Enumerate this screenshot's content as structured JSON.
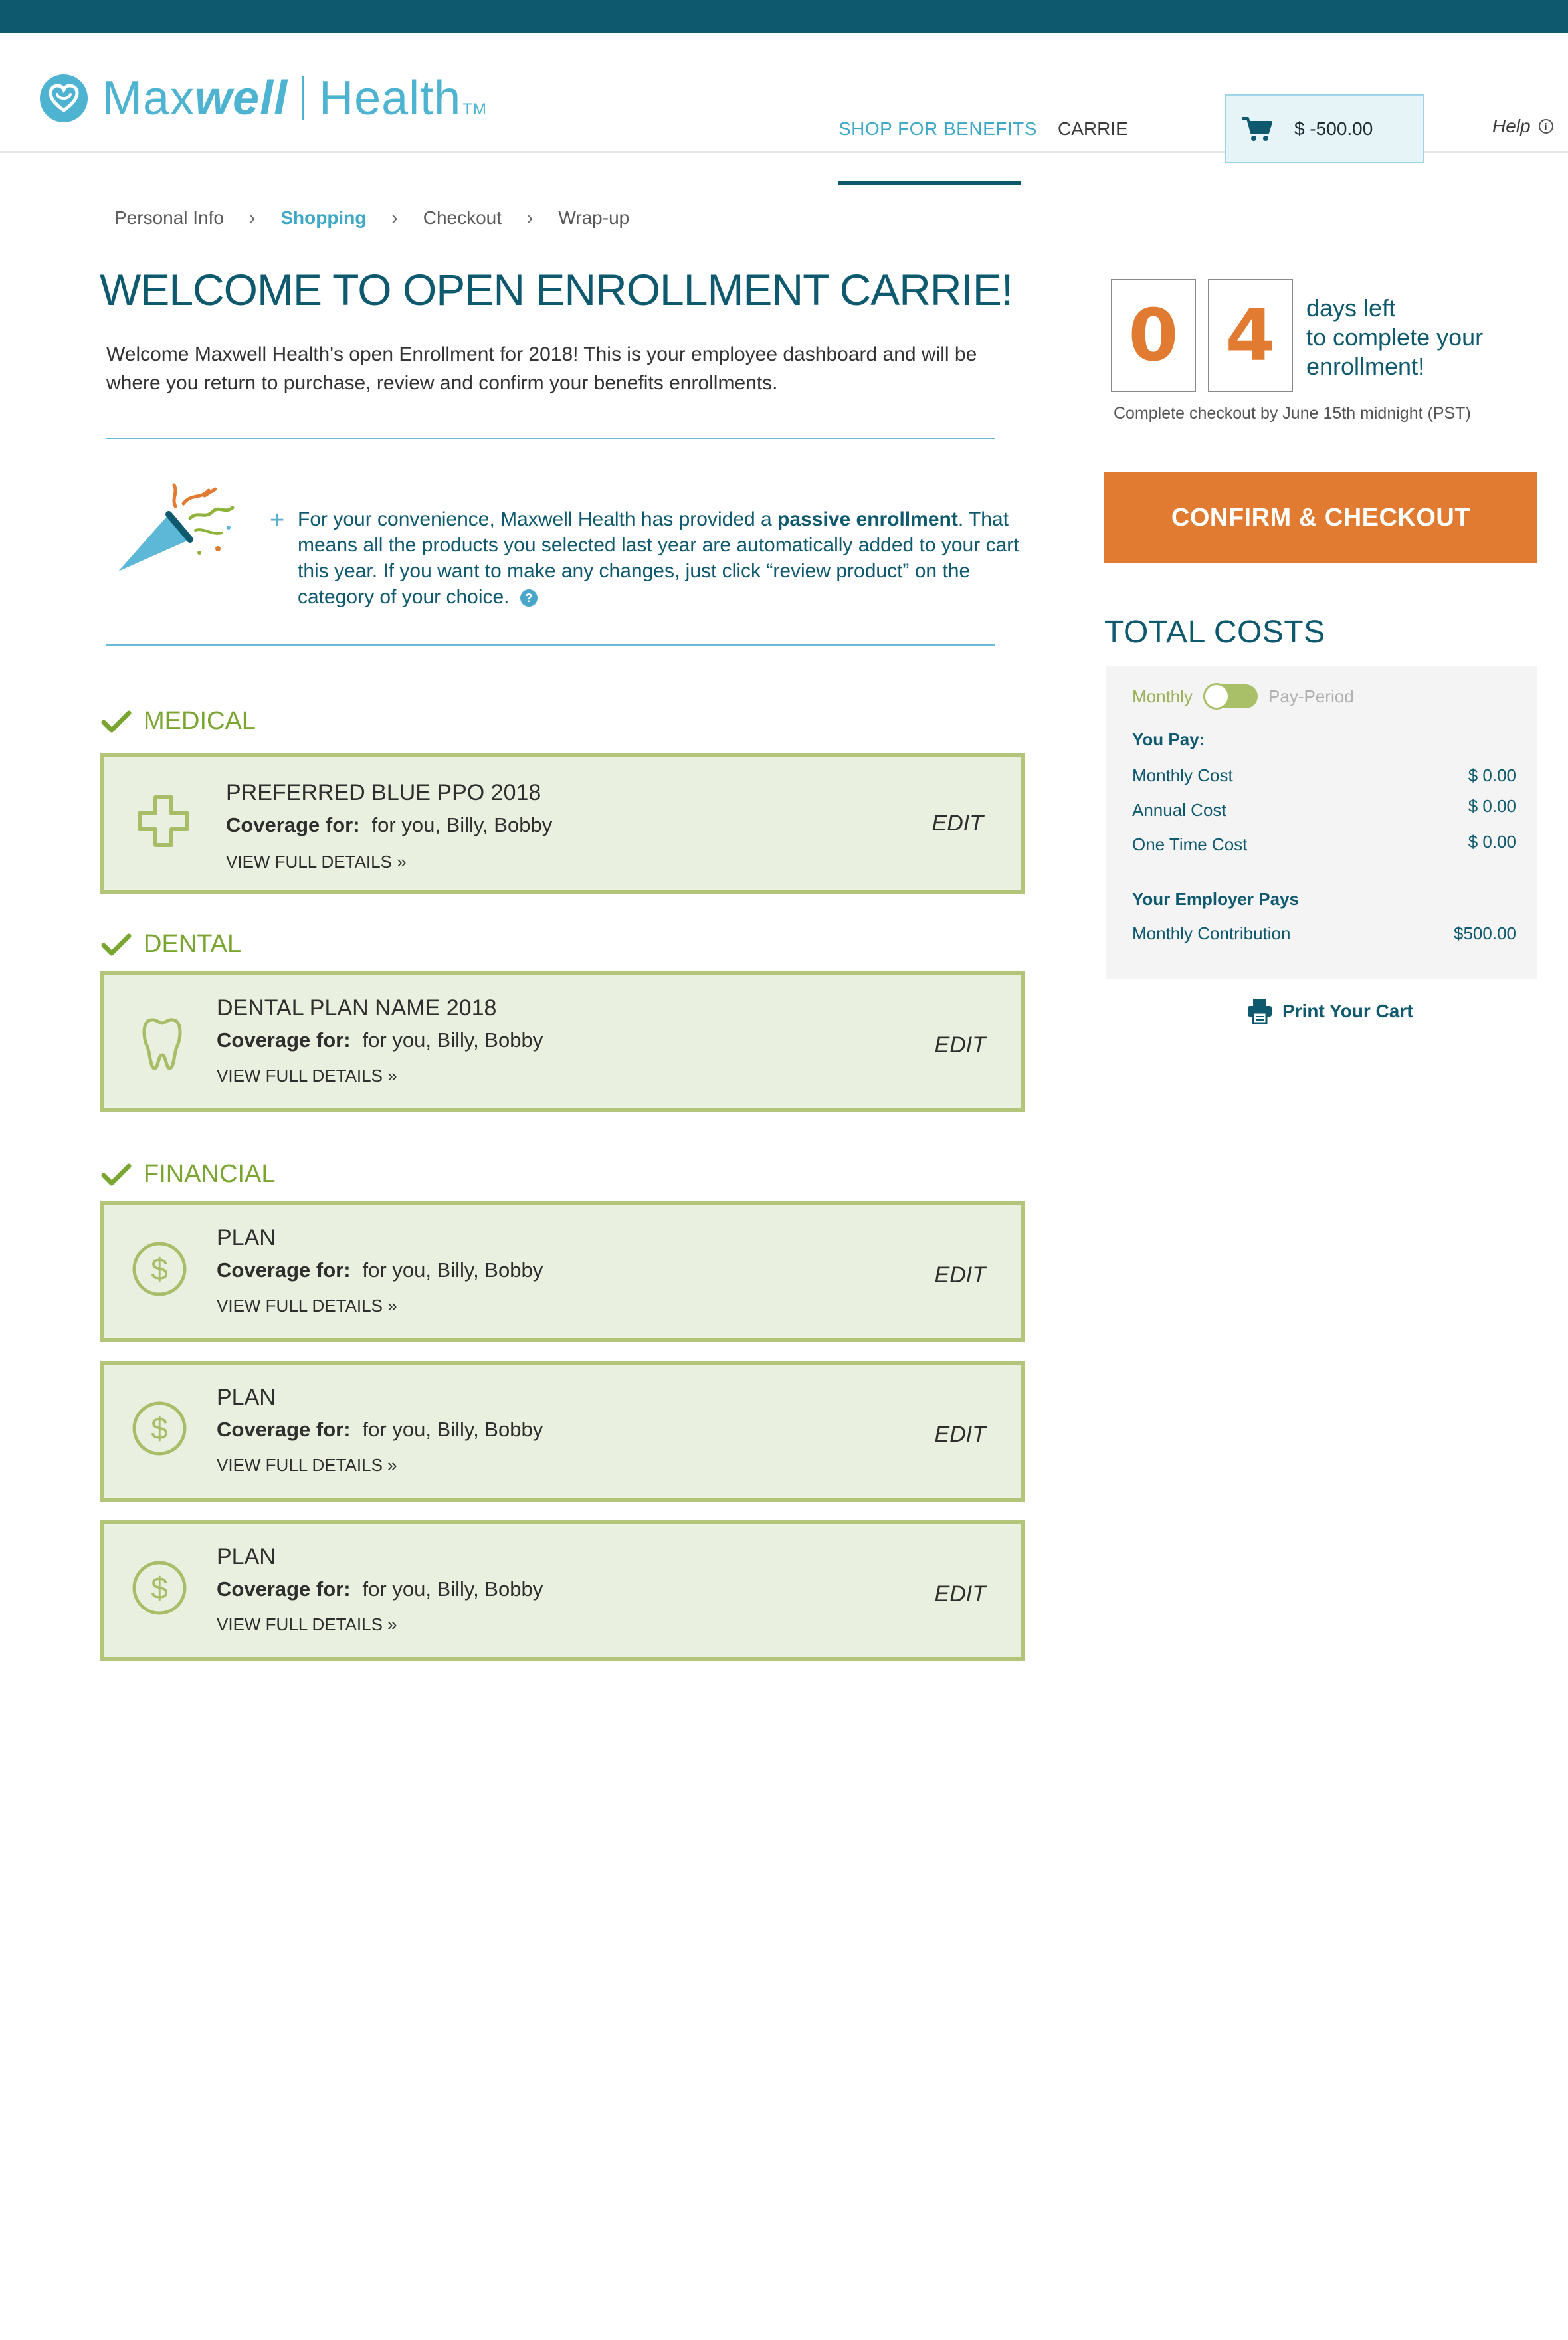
{
  "header": {
    "logo_word_1": "Max",
    "logo_word_2": "well",
    "logo_word_3": "Health",
    "logo_tm": "TM",
    "nav_shop": "SHOP FOR BENEFITS",
    "nav_user": "CARRIE",
    "cart_amount": "$  -500.00",
    "help": "Help",
    "help_icon_glyph": "i"
  },
  "breadcrumb": {
    "items": [
      "Personal Info",
      "Shopping",
      "Checkout",
      "Wrap-up"
    ],
    "active_index": 1,
    "separator": "›"
  },
  "welcome": {
    "title": "WELCOME  TO OPEN ENROLLMENT CARRIE!",
    "text": "Welcome Maxwell Health's open Enrollment for 2018! This is your employee dashboard and will be where you  return to purchase, review and confirm your benefits enrollments."
  },
  "notice": {
    "plus": "+",
    "text_before": "For your convenience, Maxwell Health has provided a ",
    "text_bold": "passive enrollment",
    "text_after": ". That means all the products you selected last year are automatically added to your cart this year. If you want to make any changes, just click “review product” on the category of your choice.",
    "help_glyph": "?"
  },
  "sections": {
    "medical": "MEDICAL",
    "dental": "DENTAL",
    "financial": "FINANCIAL"
  },
  "cards": [
    {
      "name": "PREFERRED BLUE PPO 2018",
      "coverage_label": "Coverage for:",
      "coverage": "for you, Billy, Bobby",
      "link": "VIEW FULL DETAILS »",
      "edit": "EDIT",
      "icon": "medical-cross-icon"
    },
    {
      "name": "DENTAL PLAN NAME 2018",
      "coverage_label": "Coverage for:",
      "coverage": "for you, Billy, Bobby",
      "link": "VIEW FULL DETAILS »",
      "edit": "EDIT",
      "icon": "tooth-icon"
    },
    {
      "name": "PLAN",
      "coverage_label": "Coverage for:",
      "coverage": "for you, Billy, Bobby",
      "link": "VIEW FULL DETAILS »",
      "edit": "EDIT",
      "icon": "dollar-icon"
    },
    {
      "name": "PLAN",
      "coverage_label": "Coverage for:",
      "coverage": "for you, Billy, Bobby",
      "link": "VIEW FULL DETAILS »",
      "edit": "EDIT",
      "icon": "dollar-icon"
    },
    {
      "name": "PLAN",
      "coverage_label": "Coverage for:",
      "coverage": "for you, Billy, Bobby",
      "link": "VIEW FULL DETAILS »",
      "edit": "EDIT",
      "icon": "dollar-icon"
    }
  ],
  "countdown": {
    "digit_1": "0",
    "digit_2": "4",
    "days_left": "days left",
    "complete_line_1": "to complete your",
    "complete_line_2": "enrollment!",
    "deadline": "Complete checkout by June 15th midnight (PST)"
  },
  "checkout_button": "CONFIRM & CHECKOUT",
  "totals": {
    "title": "TOTAL COSTS",
    "toggle_left": "Monthly",
    "toggle_right": "Pay-Period",
    "you_pay_label": "You Pay:",
    "monthly_cost_label": "Monthly Cost",
    "monthly_cost": "$ 0.00",
    "annual_cost_label": "Annual Cost",
    "annual_cost": "$ 0.00",
    "one_time_cost_label": "One Time Cost",
    "one_time_cost": "$ 0.00",
    "employer_label": "Your Employer Pays",
    "monthly_contribution_label": "Monthly Contribution",
    "monthly_contribution": "$500.00"
  },
  "print_cart": "Print Your Cart",
  "colors": {
    "brand_dark": "#0e596e",
    "brand_light": "#4db3d0",
    "accent_orange": "#e07b31",
    "card_green_border": "#b3c578",
    "card_green_bg": "#e9f0df",
    "check_green": "#7aa531"
  }
}
